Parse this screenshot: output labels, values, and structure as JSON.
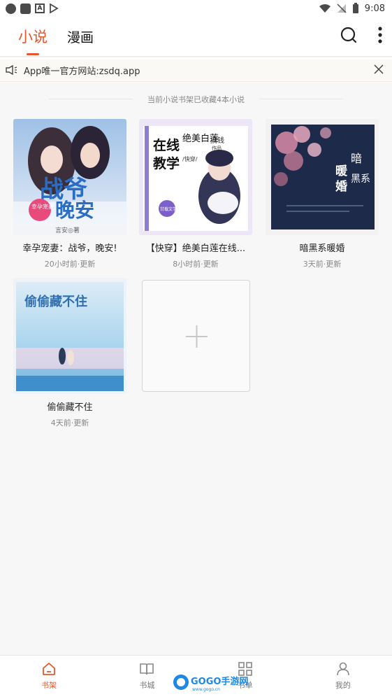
{
  "status_bar": {
    "time": "9:08"
  },
  "tabs": [
    {
      "label": "小说",
      "active": true
    },
    {
      "label": "漫画",
      "active": false
    }
  ],
  "notice": {
    "text": "App唯一官方网站:zsdq.app"
  },
  "shelf": {
    "info": "当前小说书架已收藏4本小说",
    "books": [
      {
        "title": "幸孕宠妻：战爷，晚安!",
        "updated": "20小时前·更新",
        "cover_text": {
          "main": "战爷",
          "main2": "晚安",
          "badge": "幸孕宠妻",
          "author": "言安◎著"
        }
      },
      {
        "title": "【快穿】绝美白莲在线...",
        "updated": "8小时前·更新",
        "cover_text": {
          "line1": "在线",
          "line2": "教学",
          "line3": "绝美白莲",
          "tag": "/快穿/",
          "author": "搞钱",
          "author2": "作品",
          "badge": "甘载文学"
        }
      },
      {
        "title": "暗黑系暖婚",
        "updated": "3天前·更新",
        "cover_text": {
          "t1": "暗",
          "t2": "黑系",
          "t3": "暖",
          "t4": "婚"
        }
      },
      {
        "title": "偷偷藏不住",
        "updated": "4天前·更新",
        "cover_text": {
          "main": "偷偷藏不住"
        }
      }
    ]
  },
  "bottom_nav": [
    {
      "label": "书架",
      "icon": "home-icon",
      "active": true
    },
    {
      "label": "书城",
      "icon": "book-icon",
      "active": false
    },
    {
      "label": "书单",
      "icon": "grid-icon",
      "active": false
    },
    {
      "label": "我的",
      "icon": "user-icon",
      "active": false
    }
  ],
  "watermark": {
    "text": "GOGO手游网",
    "sub": "www.gogo.cn"
  },
  "colors": {
    "accent": "#e4572e"
  }
}
